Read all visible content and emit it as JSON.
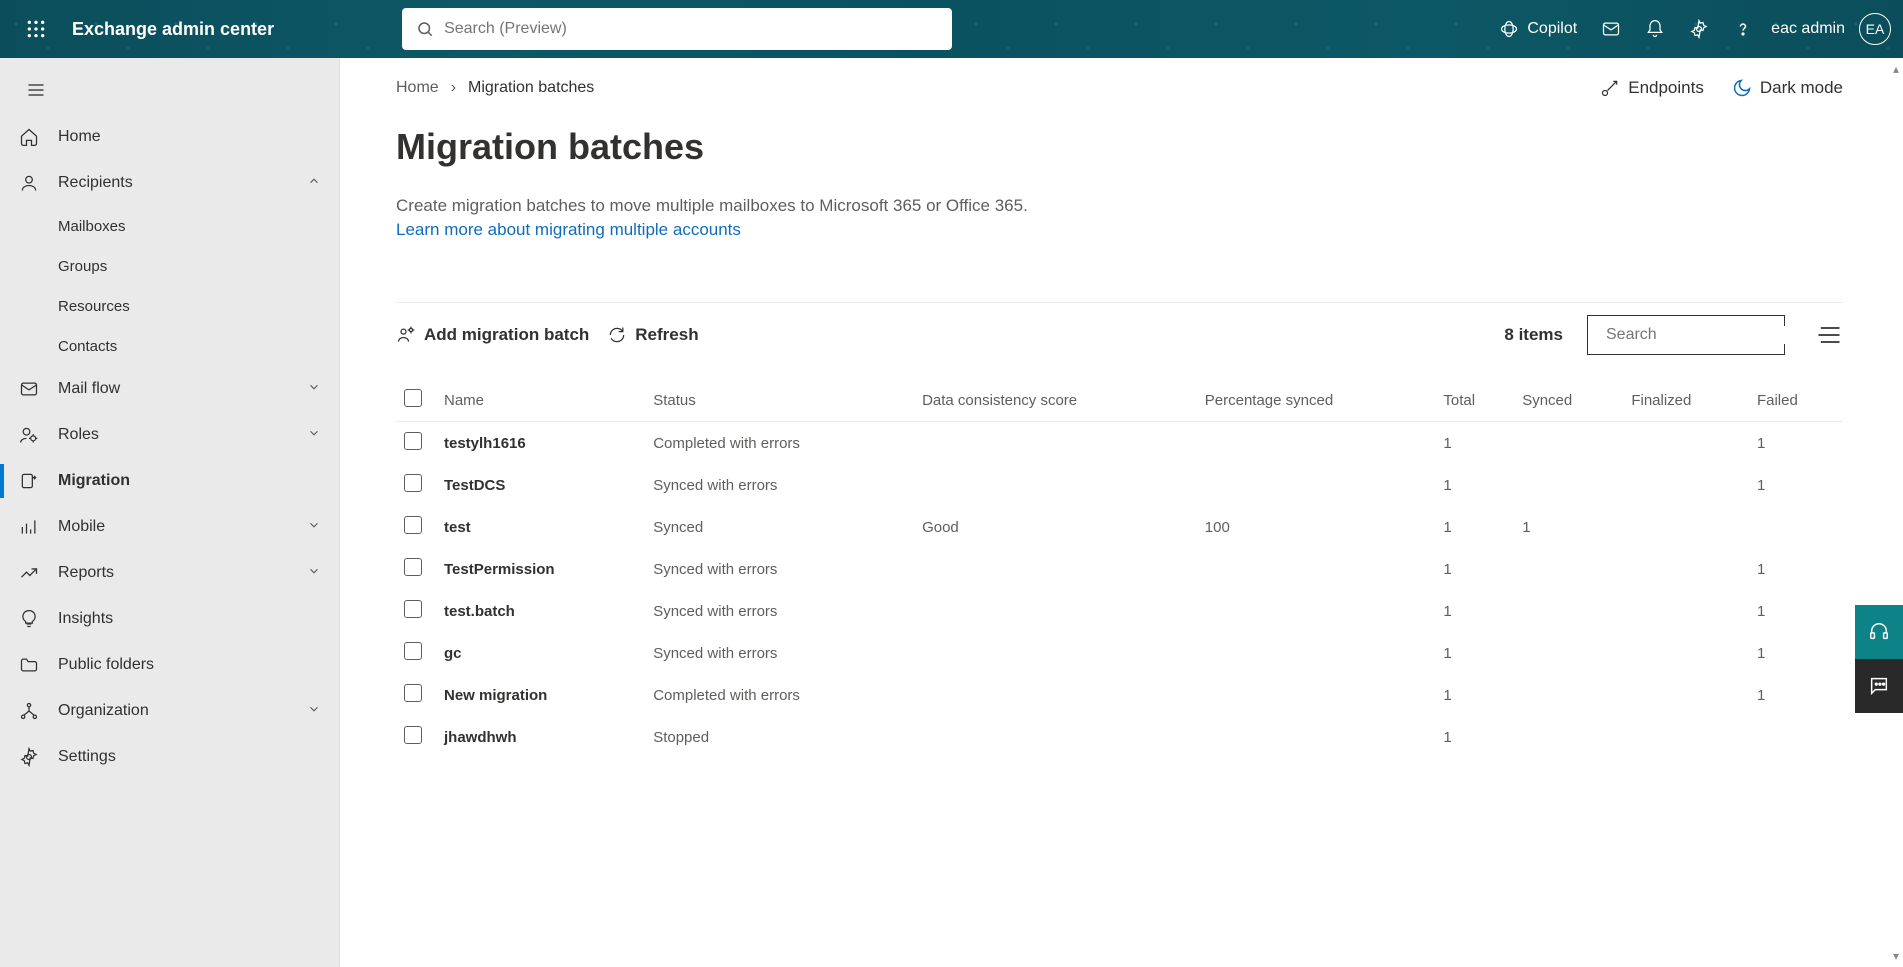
{
  "header": {
    "app_title": "Exchange admin center",
    "search_placeholder": "Search (Preview)",
    "copilot_label": "Copilot",
    "username": "eac admin",
    "avatar_initials": "EA"
  },
  "sidebar": {
    "items": [
      {
        "id": "home",
        "label": "Home",
        "type": "link"
      },
      {
        "id": "recipients",
        "label": "Recipients",
        "type": "group-expanded",
        "children": [
          "Mailboxes",
          "Groups",
          "Resources",
          "Contacts"
        ]
      },
      {
        "id": "mailflow",
        "label": "Mail flow",
        "type": "group-collapsed"
      },
      {
        "id": "roles",
        "label": "Roles",
        "type": "group-collapsed"
      },
      {
        "id": "migration",
        "label": "Migration",
        "type": "link",
        "selected": true
      },
      {
        "id": "mobile",
        "label": "Mobile",
        "type": "group-collapsed"
      },
      {
        "id": "reports",
        "label": "Reports",
        "type": "group-collapsed"
      },
      {
        "id": "insights",
        "label": "Insights",
        "type": "link"
      },
      {
        "id": "publicfolders",
        "label": "Public folders",
        "type": "link"
      },
      {
        "id": "organization",
        "label": "Organization",
        "type": "group-collapsed"
      },
      {
        "id": "settings",
        "label": "Settings",
        "type": "link"
      }
    ]
  },
  "breadcrumb": {
    "home_label": "Home",
    "current_label": "Migration batches"
  },
  "top_links": {
    "endpoints_label": "Endpoints",
    "darkmode_label": "Dark mode"
  },
  "page": {
    "title": "Migration batches",
    "description": "Create migration batches to move multiple mailboxes to Microsoft 365 or Office 365.",
    "learn_more": "Learn more about migrating multiple accounts"
  },
  "actions": {
    "add_label": "Add migration batch",
    "refresh_label": "Refresh",
    "items_count_label": "8 items",
    "search_placeholder": "Search"
  },
  "table": {
    "columns": [
      "Name",
      "Status",
      "Data consistency score",
      "Percentage synced",
      "Total",
      "Synced",
      "Finalized",
      "Failed"
    ],
    "rows": [
      {
        "name": "testylh1616",
        "status": "Completed with errors",
        "dcs": "",
        "pct": "",
        "total": "1",
        "synced": "",
        "finalized": "",
        "failed": "1"
      },
      {
        "name": "TestDCS",
        "status": "Synced with errors",
        "dcs": "",
        "pct": "",
        "total": "1",
        "synced": "",
        "finalized": "",
        "failed": "1"
      },
      {
        "name": "test",
        "status": "Synced",
        "dcs": "Good",
        "pct": "100",
        "total": "1",
        "synced": "1",
        "finalized": "",
        "failed": ""
      },
      {
        "name": "TestPermission",
        "status": "Synced with errors",
        "dcs": "",
        "pct": "",
        "total": "1",
        "synced": "",
        "finalized": "",
        "failed": "1"
      },
      {
        "name": "test.batch",
        "status": "Synced with errors",
        "dcs": "",
        "pct": "",
        "total": "1",
        "synced": "",
        "finalized": "",
        "failed": "1"
      },
      {
        "name": "gc",
        "status": "Synced with errors",
        "dcs": "",
        "pct": "",
        "total": "1",
        "synced": "",
        "finalized": "",
        "failed": "1"
      },
      {
        "name": "New migration",
        "status": "Completed with errors",
        "dcs": "",
        "pct": "",
        "total": "1",
        "synced": "",
        "finalized": "",
        "failed": "1"
      },
      {
        "name": "jhawdhwh",
        "status": "Stopped",
        "dcs": "",
        "pct": "",
        "total": "1",
        "synced": "",
        "finalized": "",
        "failed": ""
      }
    ]
  }
}
